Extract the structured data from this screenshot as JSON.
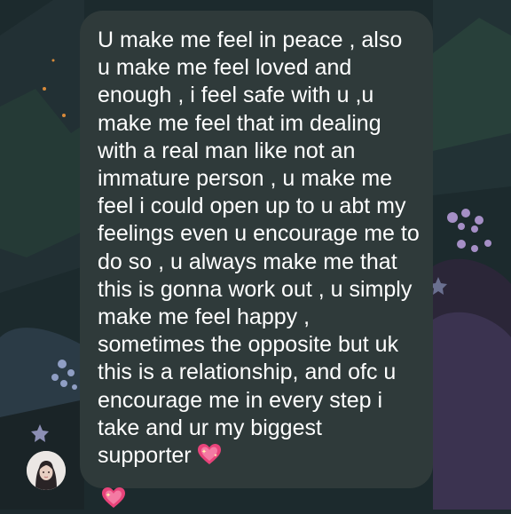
{
  "colors": {
    "background": "#1d2a2e",
    "bubble": "#2f3a3a",
    "text": "#ffffff",
    "heart": "#e8437a"
  },
  "message": {
    "text": "U make me feel in peace , also u make me feel loved and enough , i feel safe with u ,u make me feel that im dealing with a real man like not an immature person , u make me feel i could open up to u abt my feelings even u encourage me to do so , u always make me that this is gonna work out , u simply make me feel happy , sometimes the opposite but uk this is a relationship, and ofc u encourage me in every step i take and ur my biggest supporter",
    "emoji": "sparkling-heart",
    "reaction_emoji": "sparkling-heart"
  },
  "sender": {
    "avatar": "profile-photo"
  }
}
